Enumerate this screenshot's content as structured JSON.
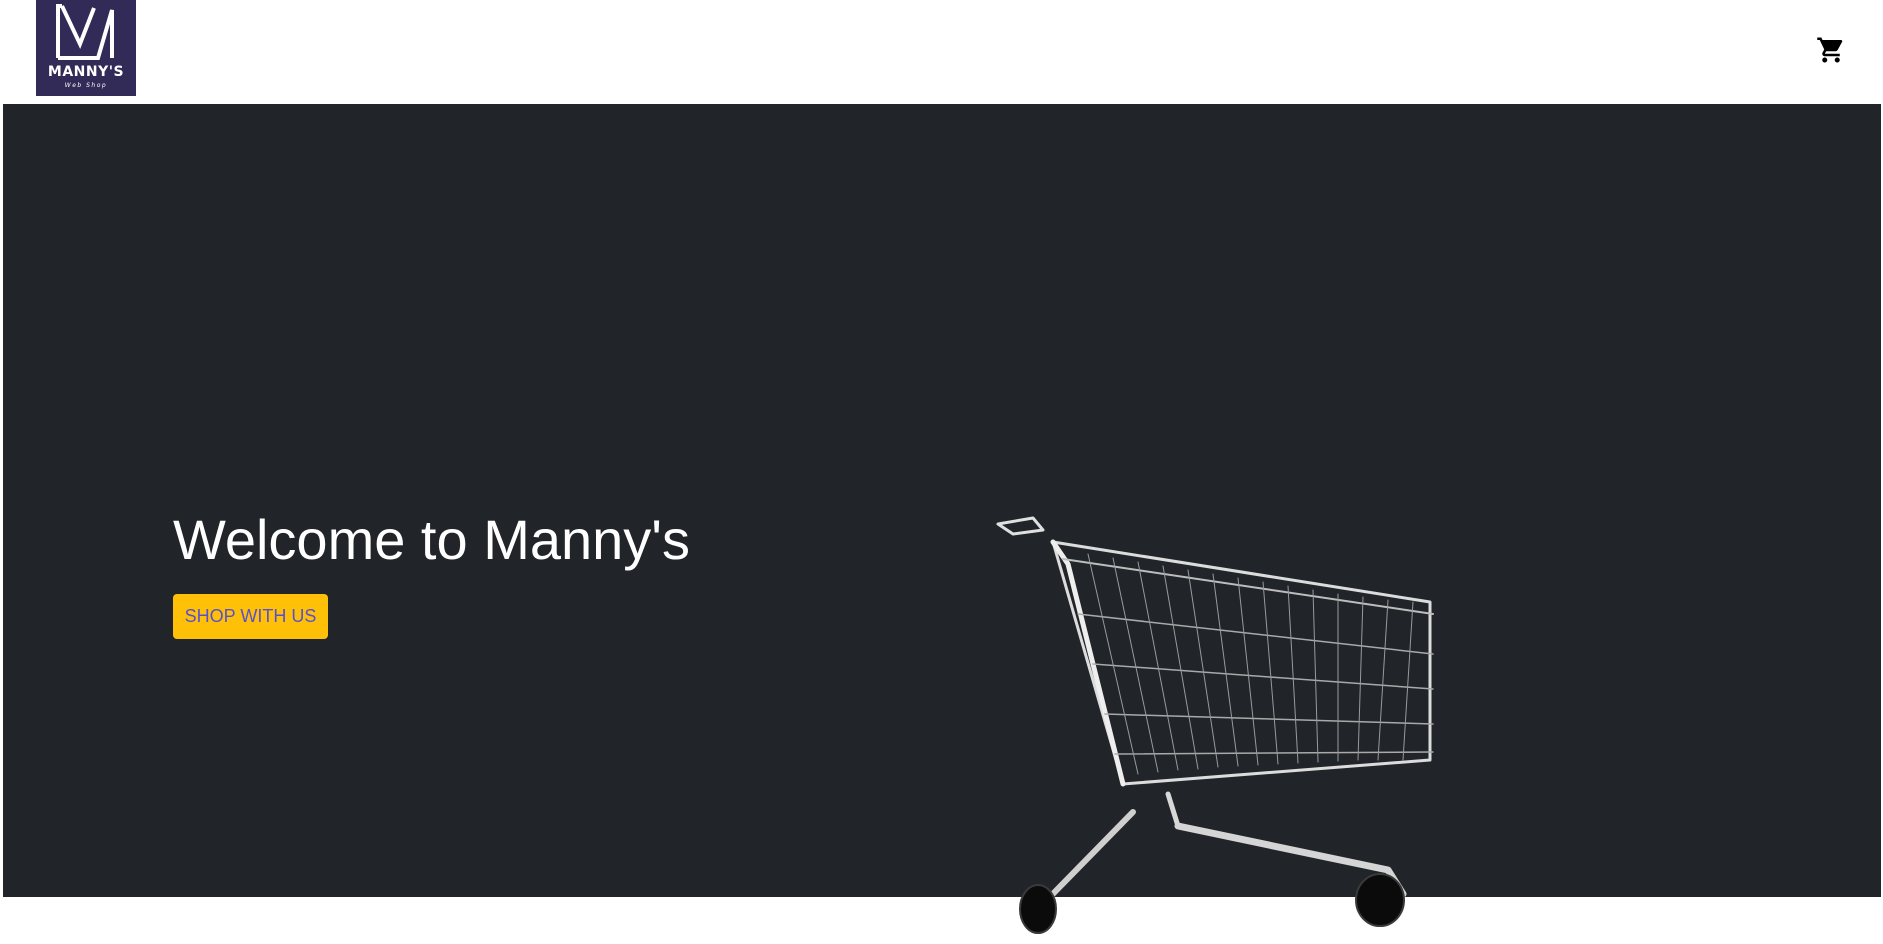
{
  "navbar": {
    "logo": {
      "name": "MANNY'S",
      "subtitle": "Web Shop",
      "background": "#322a57"
    },
    "cart_icon": "shopping-cart-icon"
  },
  "hero": {
    "title": "Welcome to Manny's",
    "button_label": "SHOP WITH US",
    "image": "shopping-cart-photo",
    "background": "#212529",
    "button_color": "#ffc107",
    "button_text_color": "#5a4fd0"
  }
}
